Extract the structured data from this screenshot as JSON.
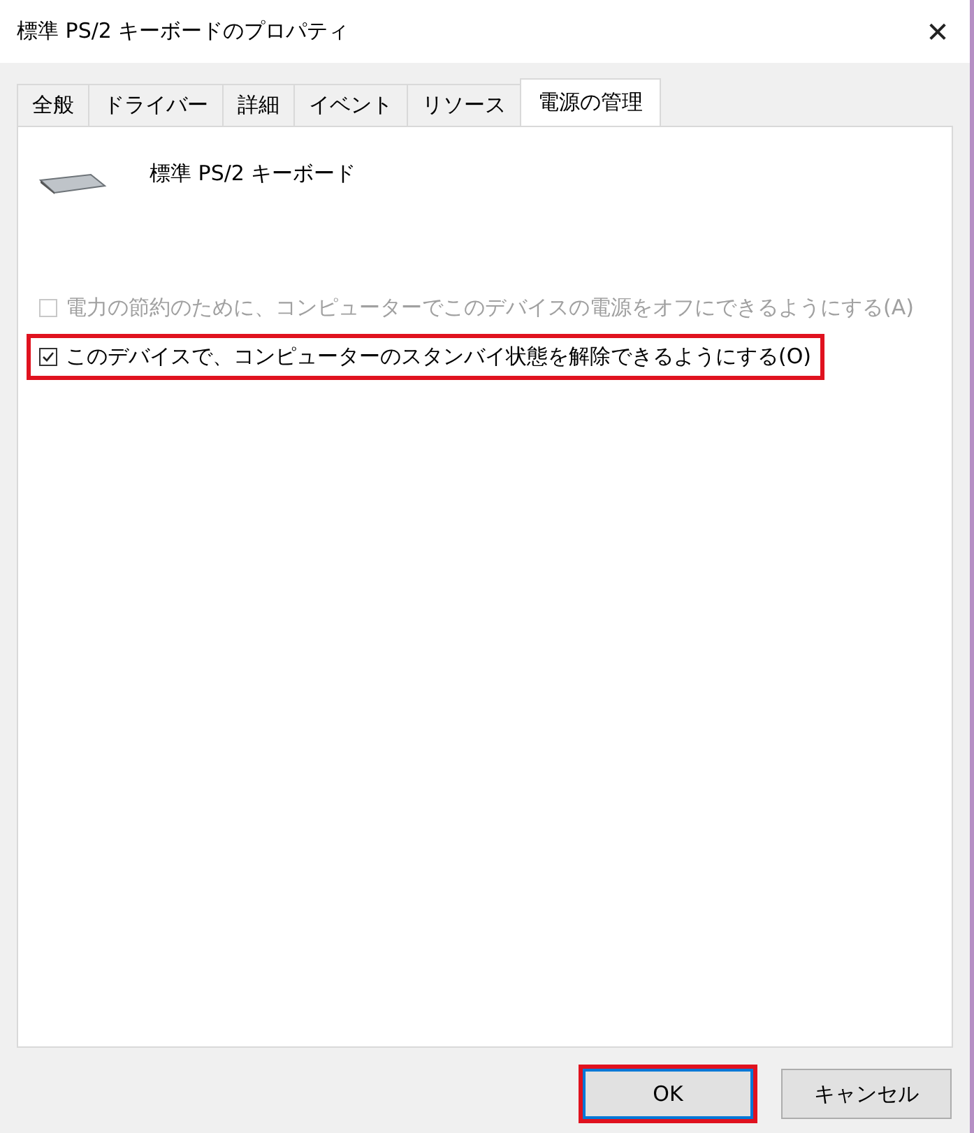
{
  "window": {
    "title": "標準 PS/2 キーボードのプロパティ",
    "close": "✕"
  },
  "tabs": [
    {
      "label": "全般",
      "selected": false
    },
    {
      "label": "ドライバー",
      "selected": false
    },
    {
      "label": "詳細",
      "selected": false
    },
    {
      "label": "イベント",
      "selected": false
    },
    {
      "label": "リソース",
      "selected": false
    },
    {
      "label": "電源の管理",
      "selected": true
    }
  ],
  "device": {
    "name": "標準 PS/2 キーボード"
  },
  "options": [
    {
      "label": "電力の節約のために、コンピューターでこのデバイスの電源をオフにできるようにする(A)",
      "checked": false,
      "disabled": true,
      "highlighted": false
    },
    {
      "label": "このデバイスで、コンピューターのスタンバイ状態を解除できるようにする(O)",
      "checked": true,
      "disabled": false,
      "highlighted": true
    }
  ],
  "buttons": [
    {
      "label": "OK",
      "default": true,
      "highlighted": true
    },
    {
      "label": "キャンセル",
      "default": false,
      "highlighted": false
    }
  ]
}
